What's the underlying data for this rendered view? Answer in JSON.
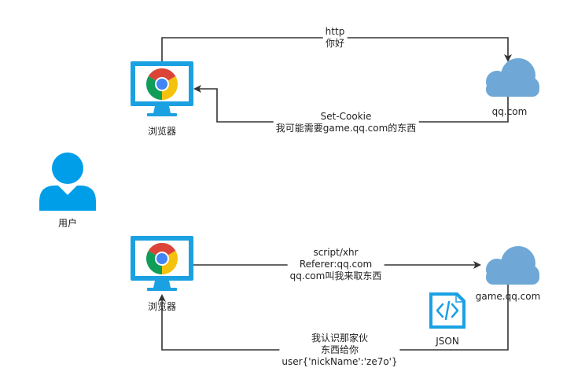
{
  "nodes": {
    "browser_top": {
      "label": "浏览器"
    },
    "browser_bottom": {
      "label": "浏览器"
    },
    "user": {
      "label": "用户"
    },
    "cloud_qq": {
      "label": "qq.com"
    },
    "cloud_game": {
      "label": "game.qq.com"
    },
    "json_file": {
      "label": "JSON"
    }
  },
  "edges": {
    "top_request": {
      "lines": [
        "http",
        "你好"
      ]
    },
    "top_response": {
      "lines": [
        "Set-Cookie",
        "我可能需要game.qq.com的东西"
      ]
    },
    "bottom_request": {
      "lines": [
        "script/xhr",
        "Referer:qq.com",
        "qq.com叫我来取东西"
      ]
    },
    "bottom_response": {
      "lines": [
        "我认识那家伙",
        "东西给你",
        "user{'nickName':'ze7o'}"
      ]
    }
  },
  "colors": {
    "arrow": "#333333",
    "monitor": "#1ba1e2",
    "user": "#009ee8",
    "cloud": "#6fa8d6",
    "json_icon": "#1ba1e2"
  }
}
